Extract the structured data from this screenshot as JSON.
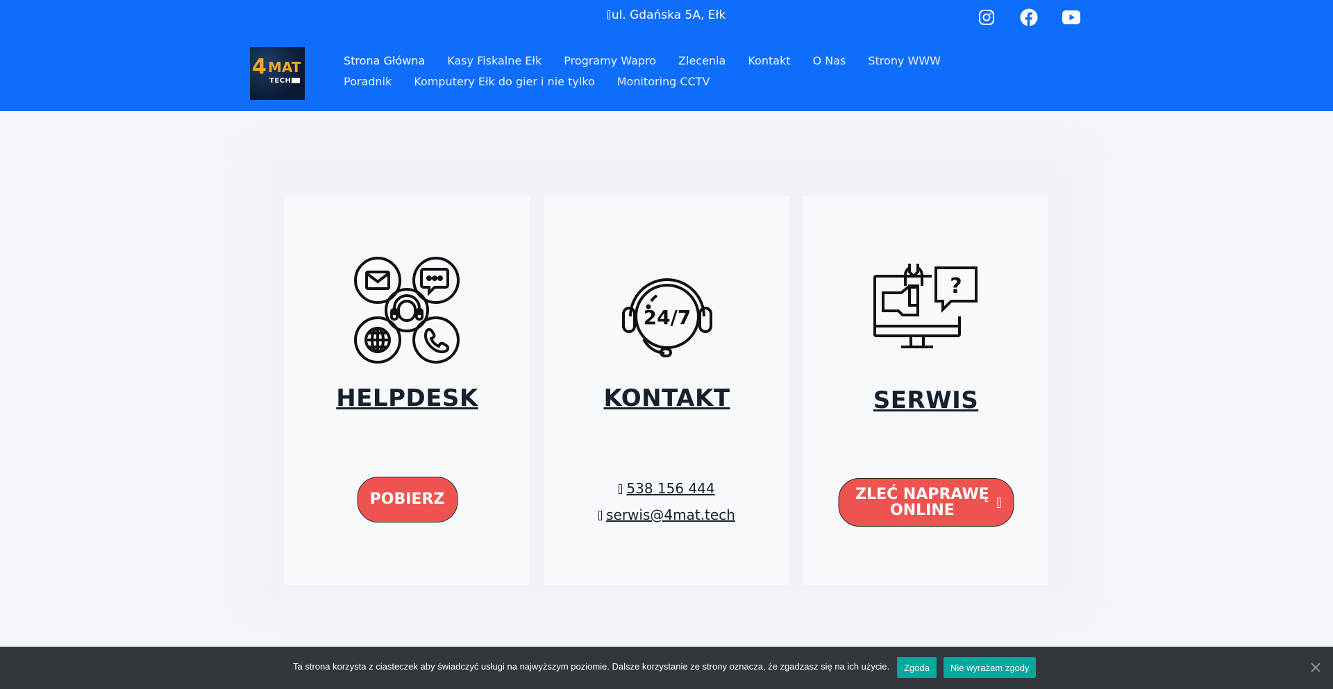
{
  "topbar": {
    "address": "ul. Gdańska 5A, Ełk",
    "social": [
      "instagram-icon",
      "facebook-icon",
      "youtube-icon"
    ]
  },
  "logo": {
    "num": "4",
    "mat": "MAT",
    "tech": "TECH"
  },
  "nav": {
    "items": [
      {
        "label": "Strona Główna",
        "active": true
      },
      {
        "label": "Kasy Fiskalne Ełk"
      },
      {
        "label": "Programy Wapro"
      },
      {
        "label": "Zlecenia"
      },
      {
        "label": "Kontakt"
      },
      {
        "label": "O Nas"
      },
      {
        "label": "Strony WWW"
      },
      {
        "label": "Poradnik"
      },
      {
        "label": "Komputery Ełk do gier i nie tylko"
      },
      {
        "label": "Monitoring CCTV"
      }
    ]
  },
  "cards": {
    "helpdesk": {
      "title": "HELPDESK",
      "button": "POBIERZ",
      "icon": "helpdesk-icon"
    },
    "kontakt": {
      "title": "KONTAKT",
      "phone": "538 156 444",
      "email": "serwis@4mat.tech",
      "icon": "support-24-7-icon"
    },
    "serwis": {
      "title": "SERWIS",
      "button": "ZLEĆ NAPRAWĘ ONLINE",
      "icon": "repair-monitor-icon"
    }
  },
  "cookie": {
    "text": "Ta strona korzysta z ciasteczek aby świadczyć usługi na najwyższym poziomie. Dalsze korzystanie ze strony oznacza, że zgadzasz się na ich użycie.",
    "accept": "Zgoda",
    "decline": "Nie wyrażam zgody"
  },
  "colors": {
    "header": "#0f6dfc",
    "button": "#ef5350",
    "cookie_bg": "#32373c",
    "cookie_btn": "#00a99d"
  }
}
